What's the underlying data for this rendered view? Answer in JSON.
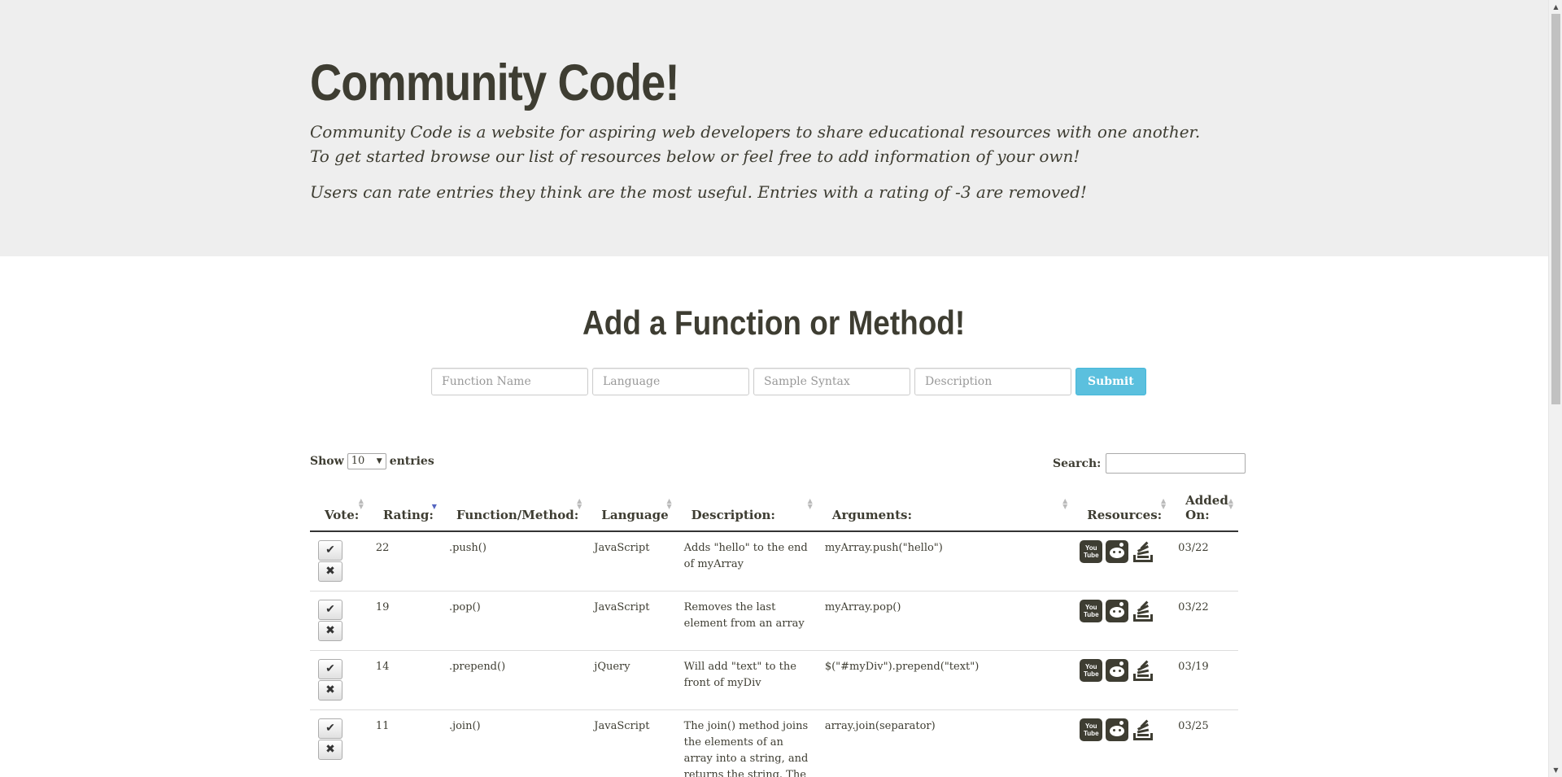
{
  "header": {
    "title": "Community Code!",
    "intro_1": "Community Code is a website for aspiring web developers to share educational resources with one another. To get started browse our list of resources below or feel free to add information of your own!",
    "intro_2": "Users can rate entries they think are the most useful. Entries with a rating of -3 are removed!"
  },
  "add_form": {
    "heading": "Add a Function or Method!",
    "function_placeholder": "Function Name",
    "language_placeholder": "Language",
    "syntax_placeholder": "Sample Syntax",
    "description_placeholder": "Description",
    "submit_label": "Submit",
    "submit_color": "#5bc0de"
  },
  "table_controls": {
    "show_label": "Show",
    "entries_value": "10",
    "entries_label": "entries",
    "search_label": "Search:"
  },
  "table": {
    "columns": [
      "Vote:",
      "Rating:",
      "Function/Method:",
      "Language",
      "Description:",
      "Arguments:",
      "Resources:",
      "Added On:"
    ],
    "sorted_column": "Rating:",
    "rows": [
      {
        "rating": "22",
        "function": ".push()",
        "language": "JavaScript",
        "description": "Adds \"hello\" to the end of myArray",
        "arguments": "myArray.push(\"hello\")",
        "added": "03/22"
      },
      {
        "rating": "19",
        "function": ".pop()",
        "language": "JavaScript",
        "description": "Removes the last element from an array",
        "arguments": "myArray.pop()",
        "added": "03/22"
      },
      {
        "rating": "14",
        "function": ".prepend()",
        "language": "jQuery",
        "description": "Will add \"text\" to the front of myDiv",
        "arguments": "$(\"#myDiv\").prepend(\"text\")",
        "added": "03/19"
      },
      {
        "rating": "11",
        "function": ".join()",
        "language": "JavaScript",
        "description": "The join() method joins the elements of an array into a string, and returns the string. The",
        "arguments": "array.join(separator)",
        "added": "03/25"
      }
    ],
    "vote_icons": {
      "up": "checkmark-icon",
      "down": "x-icon"
    },
    "resource_icons": [
      "youtube-icon",
      "reddit-icon",
      "stackoverflow-icon"
    ],
    "youtube_label": "You Tube"
  }
}
